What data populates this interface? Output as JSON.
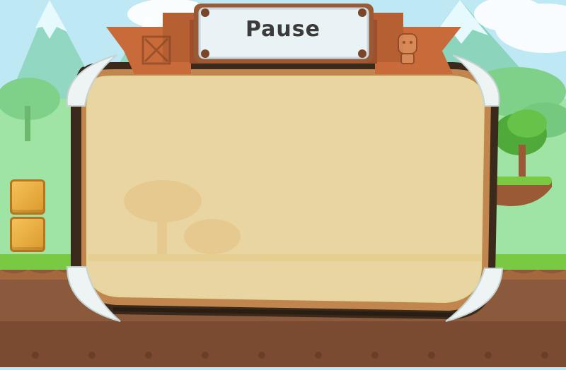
{
  "dialog": {
    "title": "Pause",
    "left_badge_icon": "crate-icon",
    "right_badge_icon": "character-icon"
  },
  "colors": {
    "sky": "#bfe8f5",
    "grass": "#7ac943",
    "dirt": "#8b5a3c",
    "panel_fill": "#f1e6b5",
    "panel_frame": "#3b2a1c",
    "ribbon": "#c86a3a"
  }
}
